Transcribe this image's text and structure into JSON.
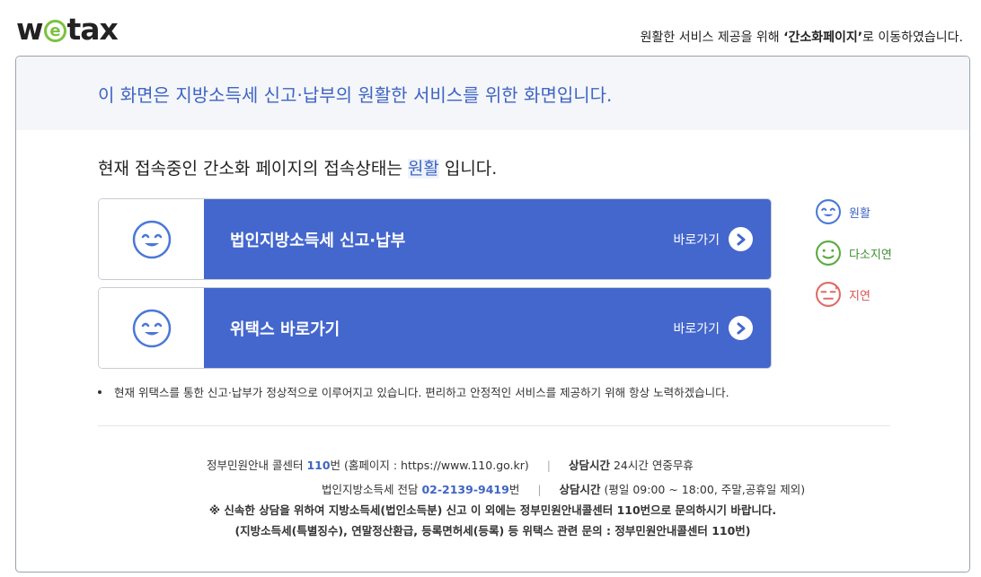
{
  "logo": {
    "pre": "w",
    "e": "e",
    "post": "tax"
  },
  "top_note": {
    "pre": "원활한 서비스 제공을 위해 ",
    "bold": "‘간소화페이지’",
    "post": "로 이동하였습니다."
  },
  "banner_text": "이 화면은 지방소득세 신고·납부의 원활한 서비스를 위한 화면입니다.",
  "status": {
    "pre": "현재 접속중인 간소화 페이지의 접속상태는 ",
    "value": "원활",
    "post": " 입니다."
  },
  "cards": [
    {
      "title": "법인지방소득세 신고·납부",
      "go_label": "바로가기"
    },
    {
      "title": "위택스 바로가기",
      "go_label": "바로가기"
    }
  ],
  "legend": [
    {
      "label": "원활",
      "color": "#3f64c3"
    },
    {
      "label": "다소지연",
      "color": "#3d8f2e"
    },
    {
      "label": "지연",
      "color": "#d9534f"
    }
  ],
  "notice": "현재 위택스를 통한 신고·납부가 정상적으로 이루어지고 있습니다. 편리하고 안정적인 서비스를 제공하기 위해 항상 노력하겠습니다.",
  "footer": {
    "line1": {
      "pre": "정부민원안내 콜센터 ",
      "num": "110",
      "post": "번 (홈페이지 : https://www.110.go.kr)",
      "hours_label": "상담시간",
      "hours": " 24시간 연중무휴"
    },
    "line2": {
      "pre": "법인지방소득세 전담 ",
      "num": "02-2139-9419",
      "post": "번",
      "hours_label": "상담시간",
      "hours": " (평일 09:00 ~ 18:00, 주말,공휴일 제외)"
    },
    "line3": "※ 신속한 상담을 위하여 지방소득세(법인소득분) 신고 이 외에는 정부민원안내콜센터 110번으로 문의하시기 바랍니다.",
    "line4": "(지방소득세(특별징수), 연말정산환급, 등록면허세(등록) 등 위택스 관련 문의 : 정부민원안내콜센터 110번)"
  },
  "colors": {
    "accent": "#4467cd",
    "banner_text": "#3f64c3",
    "logo_e": "#7cc23e"
  }
}
